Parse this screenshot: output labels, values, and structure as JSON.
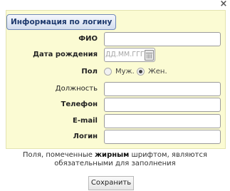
{
  "dialog": {
    "close_label": "×"
  },
  "form": {
    "legend": "Информация по логину",
    "fields": {
      "fio": {
        "label": "ФИО",
        "value": ""
      },
      "birth_date": {
        "label": "Дата рождения",
        "placeholder": "ДД.ММ.ГГГГ",
        "value": ""
      },
      "gender": {
        "label": "Пол",
        "options": [
          "Муж.",
          "Жен."
        ],
        "selected": "Жен."
      },
      "position": {
        "label": "Должность",
        "value": ""
      },
      "phone": {
        "label": "Телефон",
        "value": ""
      },
      "email": {
        "label": "E-mail",
        "value": ""
      },
      "login": {
        "label": "Логин",
        "value": ""
      }
    }
  },
  "note": {
    "before": "Поля, помеченные ",
    "bold": "жирным",
    "after": " шрифтом, являются обязательными для заполнения"
  },
  "buttons": {
    "save": "Сохранить"
  }
}
